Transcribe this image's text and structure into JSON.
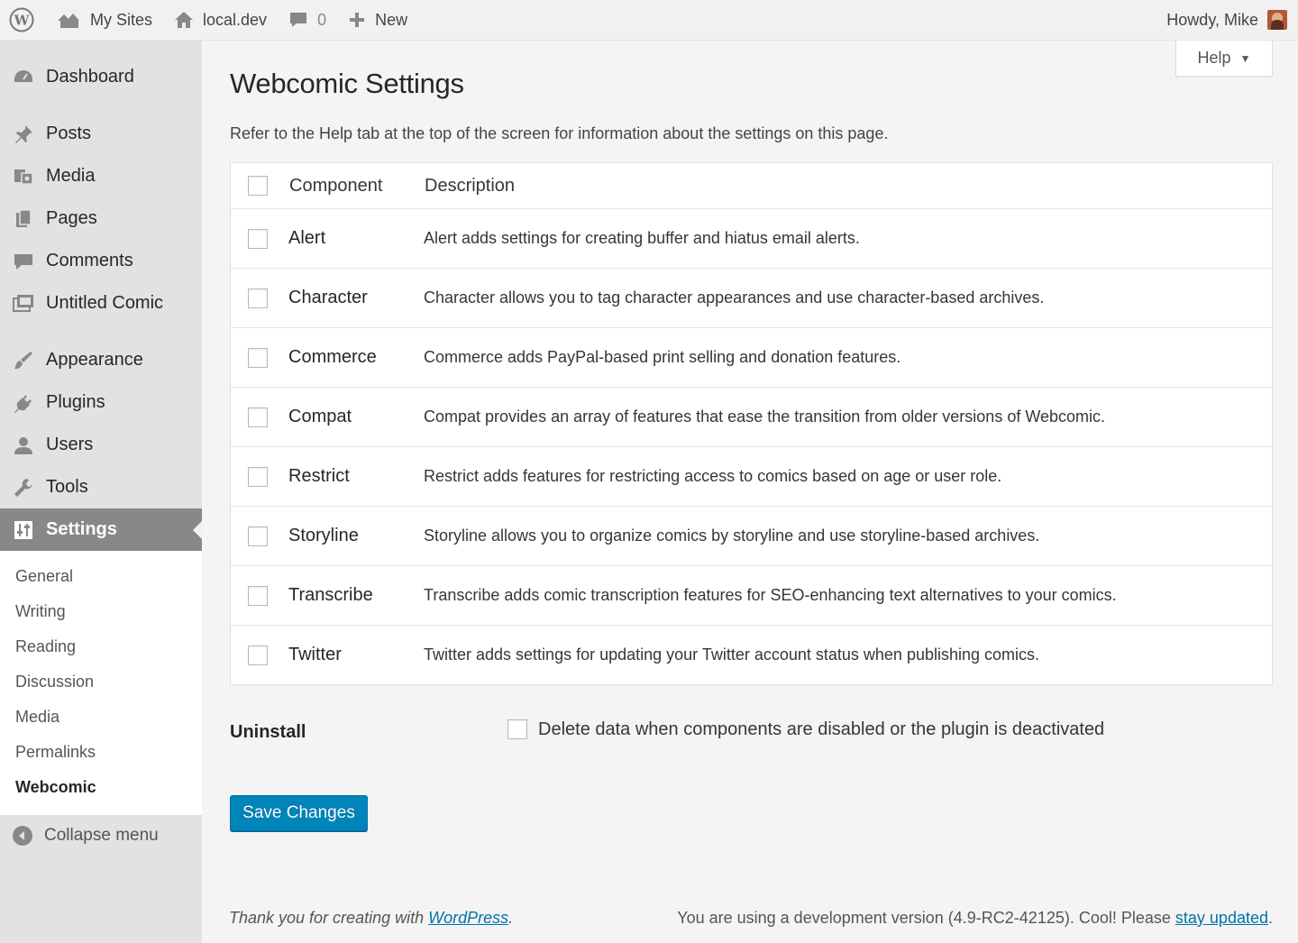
{
  "adminbar": {
    "my_sites": "My Sites",
    "site_name": "local.dev",
    "comments_count": "0",
    "new_label": "New",
    "howdy": "Howdy, Mike"
  },
  "sidebar": {
    "items": [
      {
        "label": "Dashboard",
        "icon": "dashboard-icon"
      },
      {
        "label": "Posts",
        "icon": "pin-icon"
      },
      {
        "label": "Media",
        "icon": "media-icon"
      },
      {
        "label": "Pages",
        "icon": "pages-icon"
      },
      {
        "label": "Comments",
        "icon": "comment-icon"
      },
      {
        "label": "Untitled Comic",
        "icon": "comic-icon"
      },
      {
        "label": "Appearance",
        "icon": "brush-icon"
      },
      {
        "label": "Plugins",
        "icon": "plugin-icon"
      },
      {
        "label": "Users",
        "icon": "users-icon"
      },
      {
        "label": "Tools",
        "icon": "wrench-icon"
      },
      {
        "label": "Settings",
        "icon": "sliders-icon"
      }
    ],
    "submenu": [
      "General",
      "Writing",
      "Reading",
      "Discussion",
      "Media",
      "Permalinks",
      "Webcomic"
    ],
    "collapse": "Collapse menu"
  },
  "main": {
    "help": "Help",
    "title": "Webcomic Settings",
    "intro": "Refer to the Help tab at the top of the screen for information about the settings on this page.",
    "table": {
      "headers": [
        "Component",
        "Description"
      ],
      "rows": [
        {
          "name": "Alert",
          "desc": "Alert adds settings for creating buffer and hiatus email alerts."
        },
        {
          "name": "Character",
          "desc": "Character allows you to tag character appearances and use character-based archives."
        },
        {
          "name": "Commerce",
          "desc": "Commerce adds PayPal-based print selling and donation features."
        },
        {
          "name": "Compat",
          "desc": "Compat provides an array of features that ease the transition from older versions of Webcomic."
        },
        {
          "name": "Restrict",
          "desc": "Restrict adds features for restricting access to comics based on age or user role."
        },
        {
          "name": "Storyline",
          "desc": "Storyline allows you to organize comics by storyline and use storyline-based archives."
        },
        {
          "name": "Transcribe",
          "desc": "Transcribe adds comic transcription features for SEO-enhancing text alternatives to your comics."
        },
        {
          "name": "Twitter",
          "desc": "Twitter adds settings for updating your Twitter account status when publishing comics."
        }
      ]
    },
    "uninstall": {
      "label": "Uninstall",
      "option": "Delete data when components are disabled or the plugin is deactivated"
    },
    "save_label": "Save Changes"
  },
  "footer": {
    "left_prefix": "Thank you for creating with ",
    "left_link": "WordPress",
    "left_suffix": ".",
    "right_prefix": "You are using a development version (4.9-RC2-42125). Cool! Please ",
    "right_link": "stay updated",
    "right_suffix": "."
  },
  "colors": {
    "accent": "#0085ba",
    "link": "#0073aa",
    "sidebar_bg": "#e2e2e2",
    "current_menu_bg": "#888888"
  }
}
